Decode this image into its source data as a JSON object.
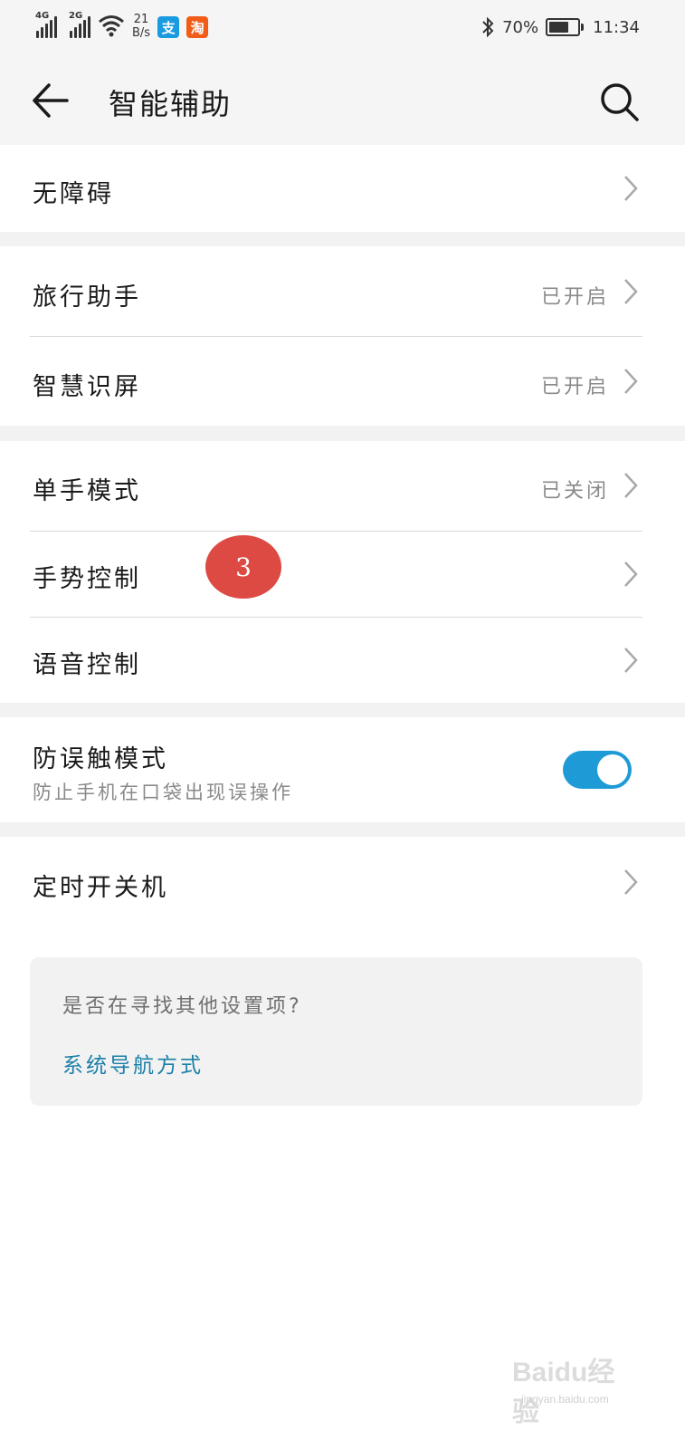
{
  "status_bar": {
    "net1": "4G",
    "net2": "2G",
    "speed_top": "21",
    "speed_bottom": "B/s",
    "app_icon_1": "支",
    "app_icon_2": "淘",
    "battery": "70%",
    "time": "11:34",
    "battery_level": 0.7,
    "icons": [
      "signal-icon",
      "wifi-icon",
      "bluetooth-icon",
      "battery-icon"
    ]
  },
  "header": {
    "title": "智能辅助",
    "back_icon": "arrow-left-icon",
    "search_icon": "search-icon"
  },
  "groups": {
    "accessibility": {
      "label": "无障碍"
    },
    "travel": {
      "label": "旅行助手",
      "value": "已开启"
    },
    "smart_screen": {
      "label": "智慧识屏",
      "value": "已开启"
    },
    "one_hand": {
      "label": "单手模式",
      "value": "已关闭"
    },
    "gesture": {
      "label": "手势控制"
    },
    "voice": {
      "label": "语音控制"
    },
    "pocket_mode": {
      "label": "防误触模式",
      "sub": "防止手机在口袋出现误操作",
      "enabled": true
    },
    "scheduled_power": {
      "label": "定时开关机"
    }
  },
  "annotation_badge": "3",
  "suggestion_card": {
    "question": "是否在寻找其他设置项?",
    "link": "系统导航方式"
  },
  "watermark": {
    "logo": "Baidu经验",
    "url": "jingyan.baidu.com"
  },
  "colors": {
    "accent": "#1e9bd7",
    "link": "#1a7fa8",
    "badge": "#dd4a44",
    "header_bg": "#f5f5f5"
  }
}
